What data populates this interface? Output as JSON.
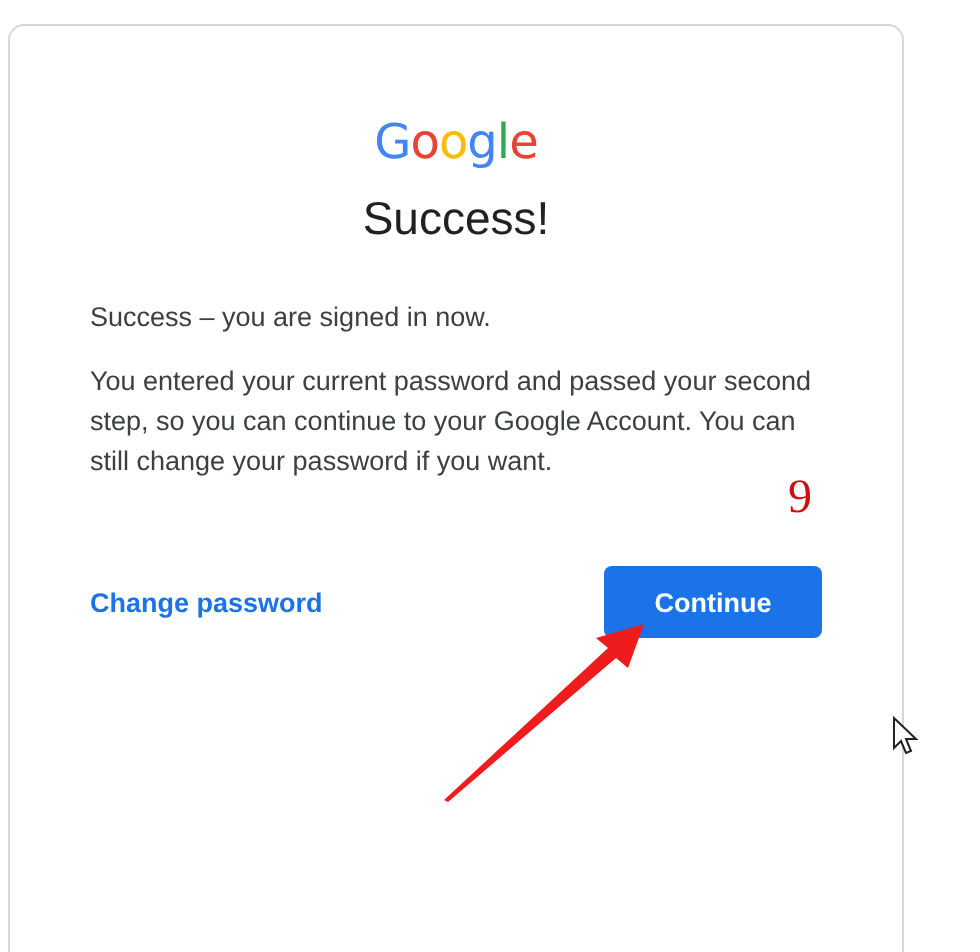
{
  "logo": [
    {
      "text": "G",
      "color": "#4285f4"
    },
    {
      "text": "o",
      "color": "#ea4335"
    },
    {
      "text": "o",
      "color": "#fbbc05"
    },
    {
      "text": "g",
      "color": "#4285f4"
    },
    {
      "text": "l",
      "color": "#34a853"
    },
    {
      "text": "e",
      "color": "#ea4335"
    }
  ],
  "title": "Success!",
  "paragraphs": [
    "Success – you are signed in now.",
    "You entered your current password and passed your second step, so you can continue to your Google Account. You can still change your password if you want."
  ],
  "link": "Change password",
  "button": "Continue",
  "annotation": {
    "label": "9"
  }
}
